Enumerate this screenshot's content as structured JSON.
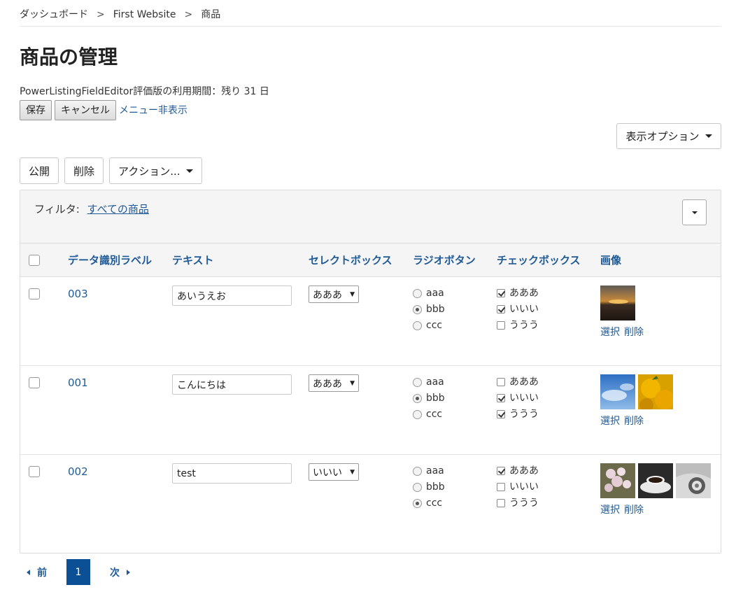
{
  "breadcrumb": [
    "ダッシュボード",
    "First Website",
    "商品"
  ],
  "breadcrumb_sep": ">",
  "page_title": "商品の管理",
  "trial_note": "PowerListingFieldEditor評価版の利用期間：残り 31 日",
  "edit_bar": {
    "save": "保存",
    "cancel": "キャンセル",
    "hide_menu": "メニュー非表示"
  },
  "display_options": "表示オプション",
  "actions": {
    "publish": "公開",
    "delete": "削除",
    "more": "アクション..."
  },
  "filter": {
    "label": "フィルタ:",
    "value": "すべての商品"
  },
  "columns": [
    "データ識別ラベル",
    "テキスト",
    "セレクトボックス",
    "ラジオボタン",
    "チェックボックス",
    "画像"
  ],
  "rows": [
    {
      "id": "003",
      "text": "あいうえお",
      "select": "あああ",
      "radios": [
        {
          "label": "aaa",
          "checked": false
        },
        {
          "label": "bbb",
          "checked": true
        },
        {
          "label": "ccc",
          "checked": false
        }
      ],
      "checks": [
        {
          "label": "あああ",
          "checked": true
        },
        {
          "label": "いいい",
          "checked": true
        },
        {
          "label": "ううう",
          "checked": false
        }
      ],
      "images": [
        "sunset"
      ]
    },
    {
      "id": "001",
      "text": "こんにちは",
      "select": "あああ",
      "radios": [
        {
          "label": "aaa",
          "checked": false
        },
        {
          "label": "bbb",
          "checked": true
        },
        {
          "label": "ccc",
          "checked": false
        }
      ],
      "checks": [
        {
          "label": "あああ",
          "checked": false
        },
        {
          "label": "いいい",
          "checked": true
        },
        {
          "label": "ううう",
          "checked": true
        }
      ],
      "images": [
        "sky",
        "oranges"
      ]
    },
    {
      "id": "002",
      "text": "test",
      "select": "いいい",
      "radios": [
        {
          "label": "aaa",
          "checked": false
        },
        {
          "label": "bbb",
          "checked": false
        },
        {
          "label": "ccc",
          "checked": true
        }
      ],
      "checks": [
        {
          "label": "あああ",
          "checked": true
        },
        {
          "label": "いいい",
          "checked": false
        },
        {
          "label": "ううう",
          "checked": false
        }
      ],
      "images": [
        "blossoms",
        "coffee",
        "car"
      ]
    }
  ],
  "image_actions": {
    "select": "選択",
    "delete": "削除"
  },
  "pagination": {
    "prev": "前",
    "current": "1",
    "next": "次"
  },
  "colors": {
    "link": "#1f5a96",
    "active_page": "#0b4f95",
    "panel_bg": "#f5f5f5"
  }
}
